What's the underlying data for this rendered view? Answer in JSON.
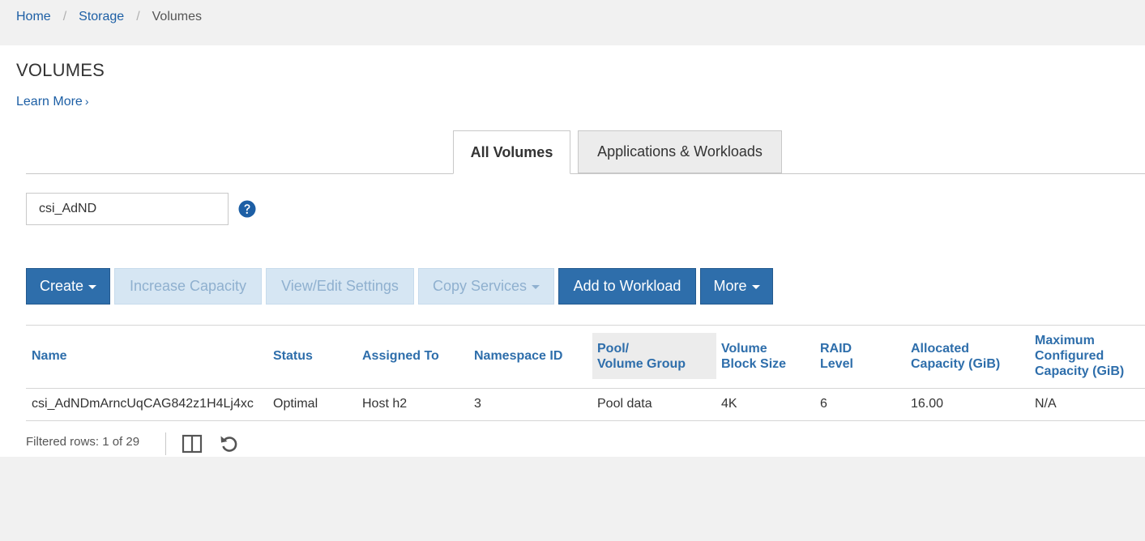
{
  "breadcrumb": {
    "home": "Home",
    "storage": "Storage",
    "separator": "/",
    "current": "Volumes"
  },
  "page": {
    "title": "VOLUMES",
    "learn_more": "Learn More",
    "learn_more_chevron": "›"
  },
  "tabs": [
    {
      "label": "All Volumes",
      "active": true
    },
    {
      "label": "Applications & Workloads",
      "active": false
    }
  ],
  "filter": {
    "value": "csi_AdND",
    "help_icon": "question-circle-icon"
  },
  "toolbar": {
    "create": "Create",
    "increase_capacity": "Increase Capacity",
    "view_edit_settings": "View/Edit Settings",
    "copy_services": "Copy Services",
    "add_to_workload": "Add to Workload",
    "more": "More"
  },
  "table": {
    "columns": [
      "Name",
      "Status",
      "Assigned To",
      "Namespace ID",
      "Pool/\nVolume Group",
      "Volume\nBlock Size",
      "RAID\nLevel",
      "Allocated\nCapacity (GiB)",
      "Maximum\nConfigured\nCapacity (GiB)"
    ],
    "rows": [
      [
        "csi_AdNDmArncUqCAG842z1H4Lj4xc",
        "Optimal",
        "Host h2",
        "3",
        "Pool data",
        "4K",
        "6",
        "16.00",
        "N/A"
      ]
    ]
  },
  "footer": {
    "filtered_rows": "Filtered rows: 1 of 29",
    "columns_icon": "columns-icon",
    "refresh_icon": "refresh-icon"
  },
  "colors": {
    "primary": "#2e6eab",
    "link": "#1d5fa5",
    "disabled_bg": "#d6e6f3",
    "disabled_text": "#8fb0cf"
  }
}
